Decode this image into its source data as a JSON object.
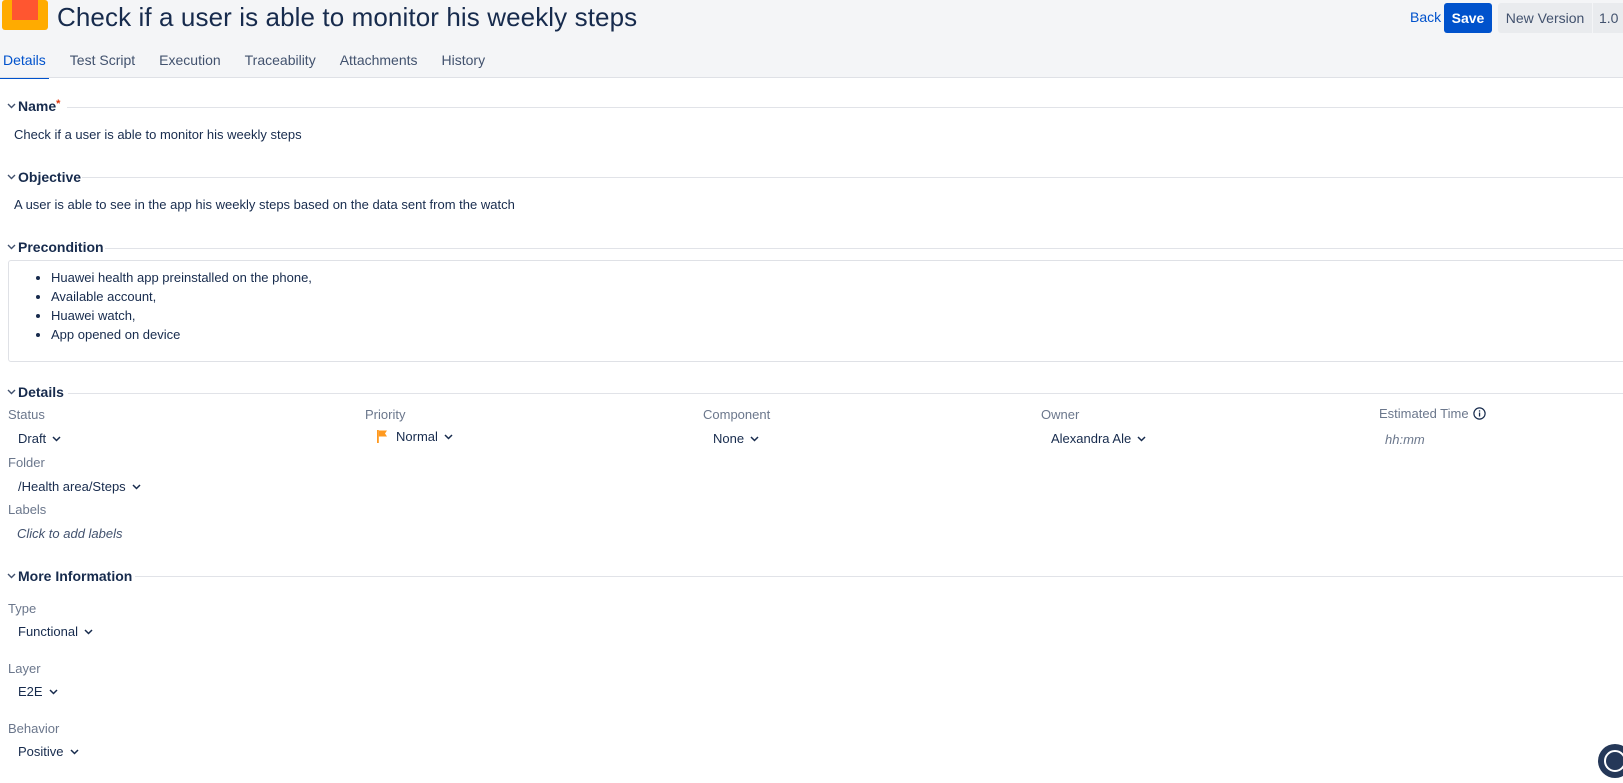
{
  "header": {
    "title": "Check if a user is able to monitor his weekly steps",
    "back_label": "Back",
    "save_label": "Save",
    "new_version_label": "New Version",
    "version_label": "1.0"
  },
  "tabs": [
    {
      "label": "Details",
      "active": true
    },
    {
      "label": "Test Script"
    },
    {
      "label": "Execution"
    },
    {
      "label": "Traceability"
    },
    {
      "label": "Attachments"
    },
    {
      "label": "History"
    }
  ],
  "sections": {
    "name": {
      "title": "Name",
      "required_mark": "*",
      "value": "Check if a user is able to monitor his weekly steps"
    },
    "objective": {
      "title": "Objective",
      "value": "A user is able to see in the app his weekly steps based on the data sent from the watch"
    },
    "precondition": {
      "title": "Precondition",
      "items": [
        "Huawei health app preinstalled on the phone,",
        "Available account,",
        "Huawei watch,",
        "App opened on device"
      ]
    },
    "details": {
      "title": "Details",
      "status": {
        "label": "Status",
        "value": "Draft"
      },
      "priority": {
        "label": "Priority",
        "value": "Normal",
        "flag_color": "#ff991f"
      },
      "component": {
        "label": "Component",
        "value": "None"
      },
      "owner": {
        "label": "Owner",
        "value": "Alexandra Ale"
      },
      "estimated_time": {
        "label": "Estimated Time",
        "placeholder": "hh:mm"
      },
      "folder": {
        "label": "Folder",
        "value": "/Health area/Steps"
      },
      "labels": {
        "label": "Labels",
        "placeholder": "Click to add labels"
      }
    },
    "more_info": {
      "title": "More Information",
      "type": {
        "label": "Type",
        "value": "Functional"
      },
      "layer": {
        "label": "Layer",
        "value": "E2E"
      },
      "behavior": {
        "label": "Behavior",
        "value": "Positive"
      }
    }
  },
  "colors": {
    "accent": "#0052cc",
    "text": "#172b4d",
    "muted": "#6b778c",
    "header_bg": "#f4f5f7",
    "icon_orange": "#ff991f",
    "icon_red": "#ff5630"
  },
  "icons": {
    "issue": "test-case-icon",
    "section_toggle": "chevron-down-icon",
    "priority": "flag-icon",
    "info": "info-icon",
    "help": "help-icon"
  }
}
